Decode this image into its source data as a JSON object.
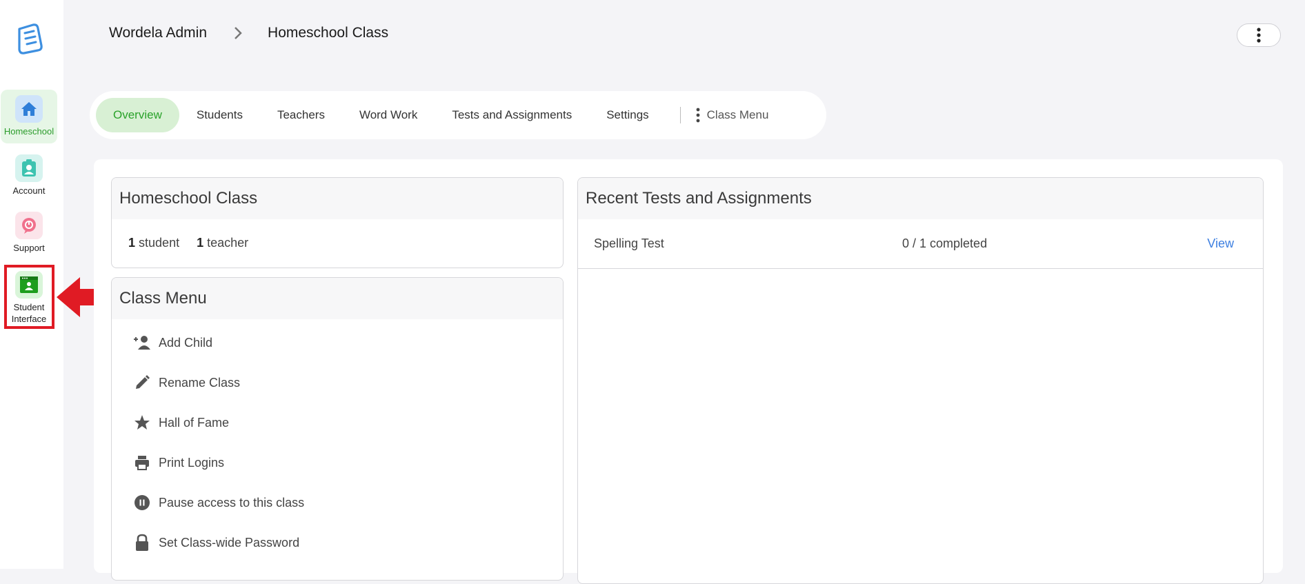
{
  "sidebar": {
    "items": [
      {
        "label": "Homeschool"
      },
      {
        "label": "Account"
      },
      {
        "label": "Support"
      },
      {
        "label": "Student Interface"
      }
    ]
  },
  "breadcrumb": {
    "root": "Wordela Admin",
    "current": "Homeschool Class"
  },
  "tabs": [
    {
      "label": "Overview",
      "active": true
    },
    {
      "label": "Students"
    },
    {
      "label": "Teachers"
    },
    {
      "label": "Word Work"
    },
    {
      "label": "Tests and Assignments"
    },
    {
      "label": "Settings"
    }
  ],
  "class_menu_tab": "Class Menu",
  "class_card": {
    "title": "Homeschool Class",
    "student_count": "1",
    "student_label": "student",
    "teacher_count": "1",
    "teacher_label": "teacher"
  },
  "class_menu": {
    "title": "Class Menu",
    "items": [
      {
        "label": "Add Child",
        "icon": "add-person-icon"
      },
      {
        "label": "Rename Class",
        "icon": "pencil-icon"
      },
      {
        "label": "Hall of Fame",
        "icon": "star-icon"
      },
      {
        "label": "Print Logins",
        "icon": "printer-icon"
      },
      {
        "label": "Pause access to this class",
        "icon": "pause-icon"
      },
      {
        "label": "Set Class-wide Password",
        "icon": "lock-icon"
      }
    ]
  },
  "recent": {
    "title": "Recent Tests and Assignments",
    "rows": [
      {
        "name": "Spelling Test",
        "status": "0 / 1 completed",
        "action": "View"
      }
    ]
  },
  "colors": {
    "accent_green": "#2aa22a",
    "link_blue": "#3d7fe0",
    "highlight_red": "#e01b24"
  }
}
